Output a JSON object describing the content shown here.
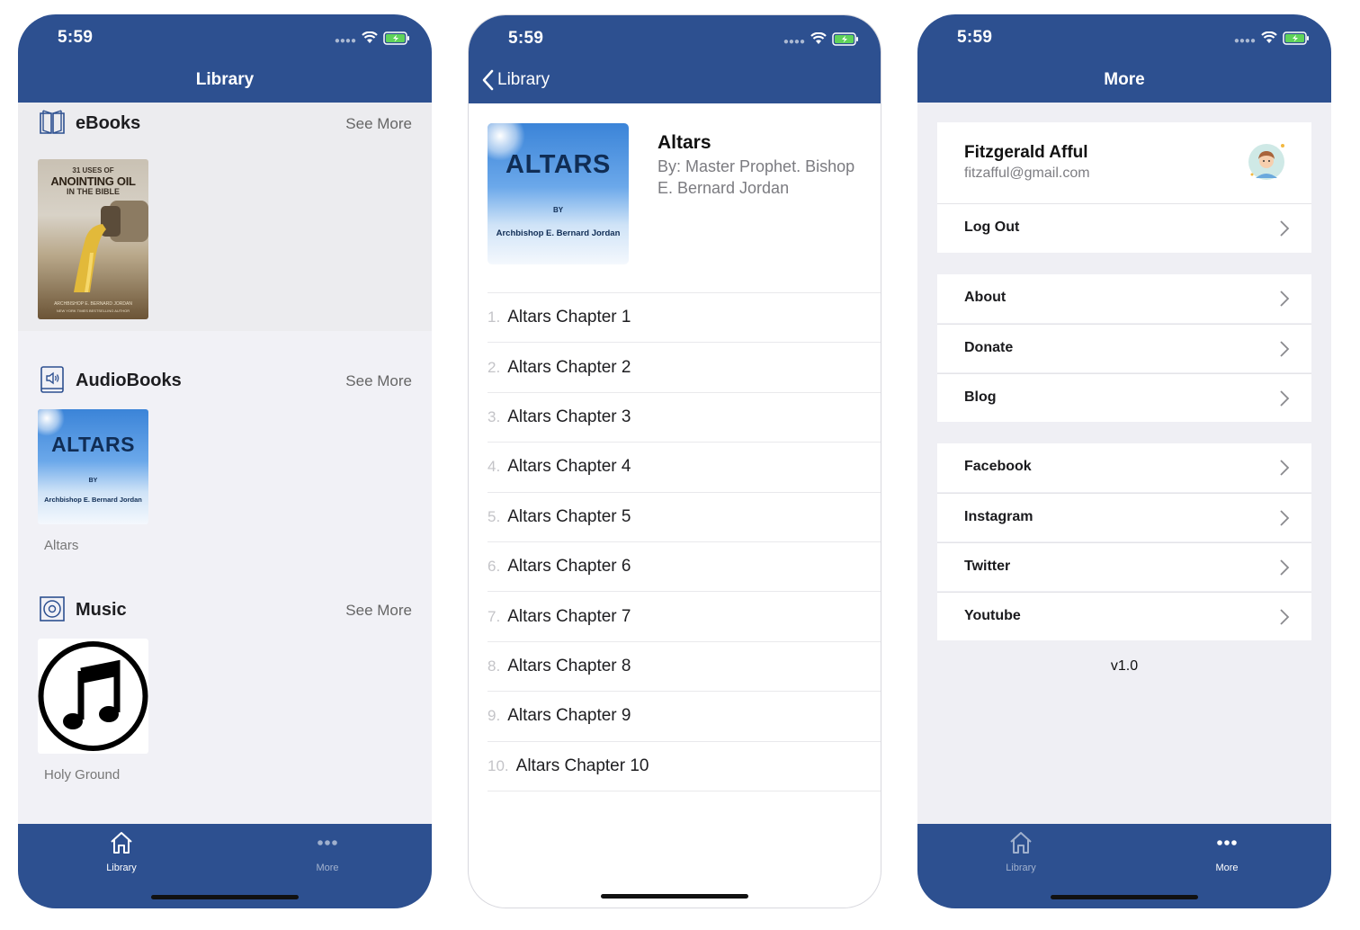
{
  "status_bar": {
    "time": "5:59"
  },
  "library": {
    "nav_title": "Library",
    "sections": [
      {
        "title": "eBooks",
        "see_more": "See More",
        "icon": "open-book-icon",
        "cover": {
          "line1": "31 USES OF",
          "line2": "ANOINTING OIL",
          "line3": "IN THE BIBLE",
          "author": "ARCHBISHOP E. BERNARD JORDAN",
          "tagline": "NEW YORK TIMES BESTSELLING AUTHOR"
        }
      },
      {
        "title": "AudioBooks",
        "see_more": "See More",
        "icon": "audiobook-icon",
        "cover": {
          "title": "ALTARS",
          "by": "BY",
          "author": "Archbishop E. Bernard Jordan"
        },
        "item_caption": "Altars"
      },
      {
        "title": "Music",
        "see_more": "See More",
        "icon": "music-disc-icon",
        "item_caption": "Holy Ground"
      }
    ]
  },
  "detail": {
    "back_label": "Library",
    "title": "Altars",
    "author": "By: Master Prophet. Bishop E. Bernard Jordan",
    "cover": {
      "title": "ALTARS",
      "by": "BY",
      "author": "Archbishop E. Bernard Jordan"
    },
    "chapters": [
      {
        "num": "1.",
        "title": "Altars Chapter 1"
      },
      {
        "num": "2.",
        "title": "Altars Chapter 2"
      },
      {
        "num": "3.",
        "title": "Altars Chapter 3"
      },
      {
        "num": "4.",
        "title": "Altars Chapter 4"
      },
      {
        "num": "5.",
        "title": "Altars Chapter 5"
      },
      {
        "num": "6.",
        "title": "Altars Chapter 6"
      },
      {
        "num": "7.",
        "title": "Altars Chapter 7"
      },
      {
        "num": "8.",
        "title": "Altars Chapter 8"
      },
      {
        "num": "9.",
        "title": "Altars Chapter 9"
      },
      {
        "num": "10.",
        "title": "Altars Chapter 10"
      }
    ]
  },
  "more": {
    "nav_title": "More",
    "profile": {
      "name": "Fitzgerald Afful",
      "email": "fitzafful@gmail.com"
    },
    "rows": {
      "logout": "Log Out",
      "about": "About",
      "donate": "Donate",
      "blog": "Blog",
      "facebook": "Facebook",
      "instagram": "Instagram",
      "twitter": "Twitter",
      "youtube": "Youtube"
    },
    "version": "v1.0"
  },
  "tabbar": {
    "library": "Library",
    "more": "More"
  },
  "colors": {
    "brand_blue": "#2d5090",
    "battery_green": "#5fd35a"
  }
}
